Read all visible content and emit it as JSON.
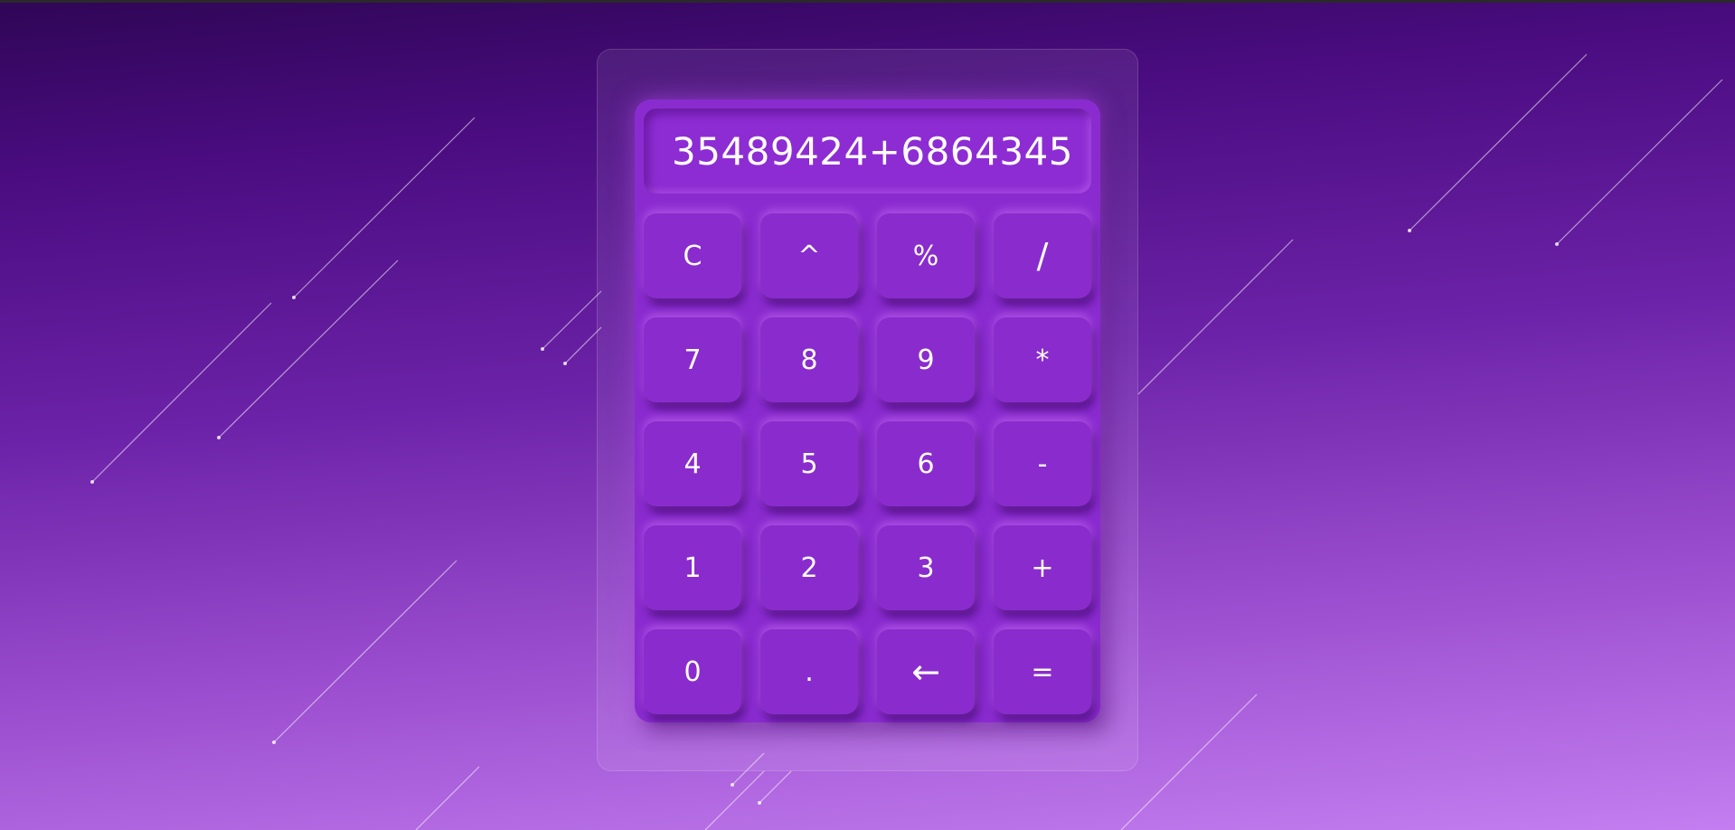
{
  "display": {
    "value": "35489424+6864345"
  },
  "keypad": [
    {
      "label": "C",
      "name": "clear-button"
    },
    {
      "label": "^",
      "name": "power-button"
    },
    {
      "label": "%",
      "name": "percent-button"
    },
    {
      "label": "/",
      "name": "divide-button"
    },
    {
      "label": "7",
      "name": "digit-7-button"
    },
    {
      "label": "8",
      "name": "digit-8-button"
    },
    {
      "label": "9",
      "name": "digit-9-button"
    },
    {
      "label": "*",
      "name": "multiply-button"
    },
    {
      "label": "4",
      "name": "digit-4-button"
    },
    {
      "label": "5",
      "name": "digit-5-button"
    },
    {
      "label": "6",
      "name": "digit-6-button"
    },
    {
      "label": "-",
      "name": "subtract-button"
    },
    {
      "label": "1",
      "name": "digit-1-button"
    },
    {
      "label": "2",
      "name": "digit-2-button"
    },
    {
      "label": "3",
      "name": "digit-3-button"
    },
    {
      "label": "+",
      "name": "add-button"
    },
    {
      "label": "0",
      "name": "digit-0-button"
    },
    {
      "label": ".",
      "name": "decimal-button"
    },
    {
      "label": "←",
      "name": "backspace-button"
    },
    {
      "label": "=",
      "name": "equals-button"
    }
  ],
  "colors": {
    "background_top": "#2f0656",
    "background_bottom": "#c47ef0",
    "calculator_body": "#8a2bd0",
    "key_face": "#8a2ccd",
    "text": "#ffffff"
  }
}
